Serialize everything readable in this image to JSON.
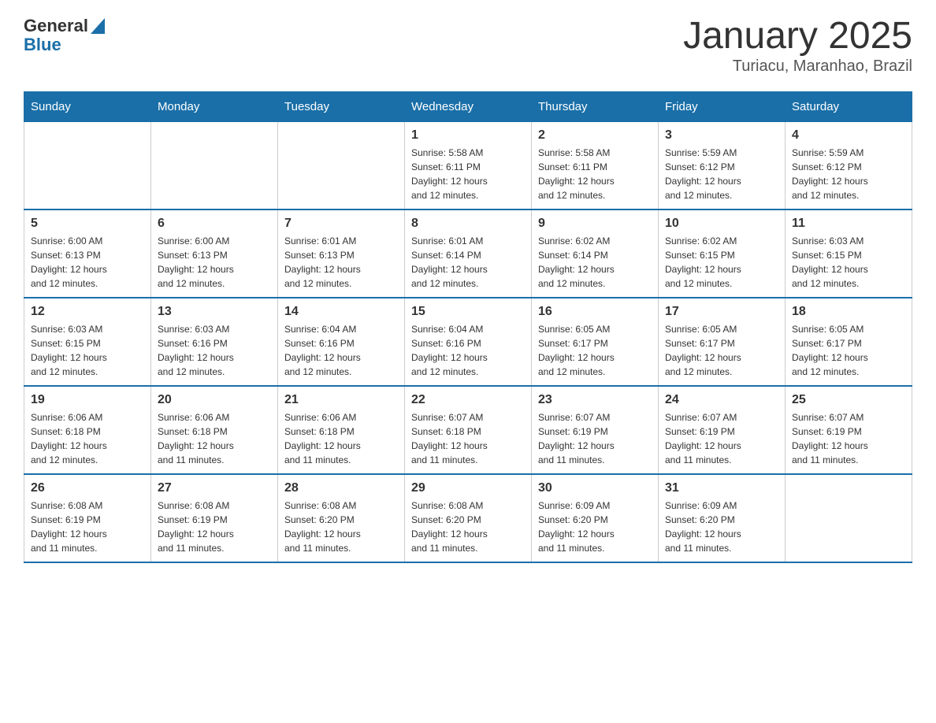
{
  "header": {
    "logo_general": "General",
    "logo_blue": "Blue",
    "title": "January 2025",
    "subtitle": "Turiacu, Maranhao, Brazil"
  },
  "weekdays": [
    "Sunday",
    "Monday",
    "Tuesday",
    "Wednesday",
    "Thursday",
    "Friday",
    "Saturday"
  ],
  "weeks": [
    [
      {
        "day": "",
        "info": ""
      },
      {
        "day": "",
        "info": ""
      },
      {
        "day": "",
        "info": ""
      },
      {
        "day": "1",
        "info": "Sunrise: 5:58 AM\nSunset: 6:11 PM\nDaylight: 12 hours\nand 12 minutes."
      },
      {
        "day": "2",
        "info": "Sunrise: 5:58 AM\nSunset: 6:11 PM\nDaylight: 12 hours\nand 12 minutes."
      },
      {
        "day": "3",
        "info": "Sunrise: 5:59 AM\nSunset: 6:12 PM\nDaylight: 12 hours\nand 12 minutes."
      },
      {
        "day": "4",
        "info": "Sunrise: 5:59 AM\nSunset: 6:12 PM\nDaylight: 12 hours\nand 12 minutes."
      }
    ],
    [
      {
        "day": "5",
        "info": "Sunrise: 6:00 AM\nSunset: 6:13 PM\nDaylight: 12 hours\nand 12 minutes."
      },
      {
        "day": "6",
        "info": "Sunrise: 6:00 AM\nSunset: 6:13 PM\nDaylight: 12 hours\nand 12 minutes."
      },
      {
        "day": "7",
        "info": "Sunrise: 6:01 AM\nSunset: 6:13 PM\nDaylight: 12 hours\nand 12 minutes."
      },
      {
        "day": "8",
        "info": "Sunrise: 6:01 AM\nSunset: 6:14 PM\nDaylight: 12 hours\nand 12 minutes."
      },
      {
        "day": "9",
        "info": "Sunrise: 6:02 AM\nSunset: 6:14 PM\nDaylight: 12 hours\nand 12 minutes."
      },
      {
        "day": "10",
        "info": "Sunrise: 6:02 AM\nSunset: 6:15 PM\nDaylight: 12 hours\nand 12 minutes."
      },
      {
        "day": "11",
        "info": "Sunrise: 6:03 AM\nSunset: 6:15 PM\nDaylight: 12 hours\nand 12 minutes."
      }
    ],
    [
      {
        "day": "12",
        "info": "Sunrise: 6:03 AM\nSunset: 6:15 PM\nDaylight: 12 hours\nand 12 minutes."
      },
      {
        "day": "13",
        "info": "Sunrise: 6:03 AM\nSunset: 6:16 PM\nDaylight: 12 hours\nand 12 minutes."
      },
      {
        "day": "14",
        "info": "Sunrise: 6:04 AM\nSunset: 6:16 PM\nDaylight: 12 hours\nand 12 minutes."
      },
      {
        "day": "15",
        "info": "Sunrise: 6:04 AM\nSunset: 6:16 PM\nDaylight: 12 hours\nand 12 minutes."
      },
      {
        "day": "16",
        "info": "Sunrise: 6:05 AM\nSunset: 6:17 PM\nDaylight: 12 hours\nand 12 minutes."
      },
      {
        "day": "17",
        "info": "Sunrise: 6:05 AM\nSunset: 6:17 PM\nDaylight: 12 hours\nand 12 minutes."
      },
      {
        "day": "18",
        "info": "Sunrise: 6:05 AM\nSunset: 6:17 PM\nDaylight: 12 hours\nand 12 minutes."
      }
    ],
    [
      {
        "day": "19",
        "info": "Sunrise: 6:06 AM\nSunset: 6:18 PM\nDaylight: 12 hours\nand 12 minutes."
      },
      {
        "day": "20",
        "info": "Sunrise: 6:06 AM\nSunset: 6:18 PM\nDaylight: 12 hours\nand 11 minutes."
      },
      {
        "day": "21",
        "info": "Sunrise: 6:06 AM\nSunset: 6:18 PM\nDaylight: 12 hours\nand 11 minutes."
      },
      {
        "day": "22",
        "info": "Sunrise: 6:07 AM\nSunset: 6:18 PM\nDaylight: 12 hours\nand 11 minutes."
      },
      {
        "day": "23",
        "info": "Sunrise: 6:07 AM\nSunset: 6:19 PM\nDaylight: 12 hours\nand 11 minutes."
      },
      {
        "day": "24",
        "info": "Sunrise: 6:07 AM\nSunset: 6:19 PM\nDaylight: 12 hours\nand 11 minutes."
      },
      {
        "day": "25",
        "info": "Sunrise: 6:07 AM\nSunset: 6:19 PM\nDaylight: 12 hours\nand 11 minutes."
      }
    ],
    [
      {
        "day": "26",
        "info": "Sunrise: 6:08 AM\nSunset: 6:19 PM\nDaylight: 12 hours\nand 11 minutes."
      },
      {
        "day": "27",
        "info": "Sunrise: 6:08 AM\nSunset: 6:19 PM\nDaylight: 12 hours\nand 11 minutes."
      },
      {
        "day": "28",
        "info": "Sunrise: 6:08 AM\nSunset: 6:20 PM\nDaylight: 12 hours\nand 11 minutes."
      },
      {
        "day": "29",
        "info": "Sunrise: 6:08 AM\nSunset: 6:20 PM\nDaylight: 12 hours\nand 11 minutes."
      },
      {
        "day": "30",
        "info": "Sunrise: 6:09 AM\nSunset: 6:20 PM\nDaylight: 12 hours\nand 11 minutes."
      },
      {
        "day": "31",
        "info": "Sunrise: 6:09 AM\nSunset: 6:20 PM\nDaylight: 12 hours\nand 11 minutes."
      },
      {
        "day": "",
        "info": ""
      }
    ]
  ]
}
